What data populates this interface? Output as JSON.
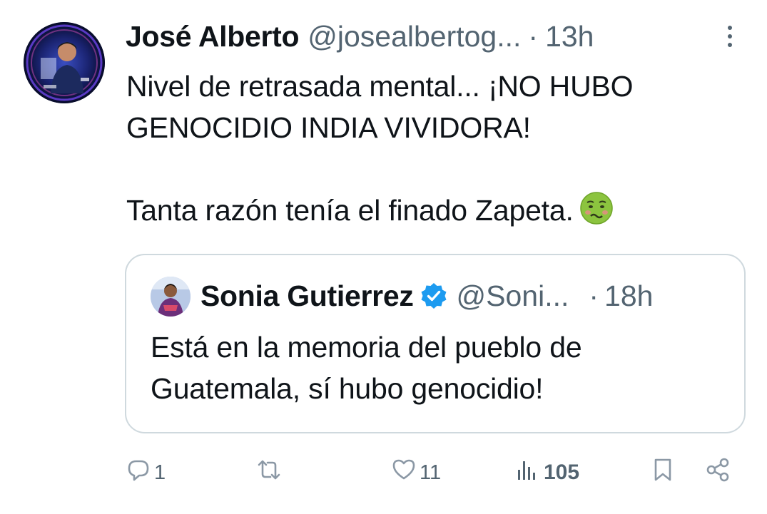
{
  "tweet": {
    "author_name": "José Alberto",
    "author_handle": "@josealbertog...",
    "separator": "·",
    "time": "13h",
    "text_line1": "Nivel de retrasada mental... ¡NO HUBO\nGENOCIDIO INDIA VIVIDORA!",
    "text_line2": "Tanta razón tenía el finado Zapeta.",
    "emoji_icon": "nauseated-face-icon"
  },
  "quoted_tweet": {
    "author_name": "Sonia Gutierrez",
    "author_handle": "@Soni...",
    "separator": "·",
    "time": "18h",
    "verified_color": "#1d9bf0",
    "text": "Está en la memoria del pueblo de\nGuatemala, sí hubo genocidio!"
  },
  "actions": {
    "replies": "1",
    "retweets": "",
    "likes": "11",
    "views": "105"
  },
  "colors": {
    "primary_text": "#0f1419",
    "secondary_text": "#536471",
    "border": "#cfd9de",
    "accent": "#1d9bf0"
  }
}
